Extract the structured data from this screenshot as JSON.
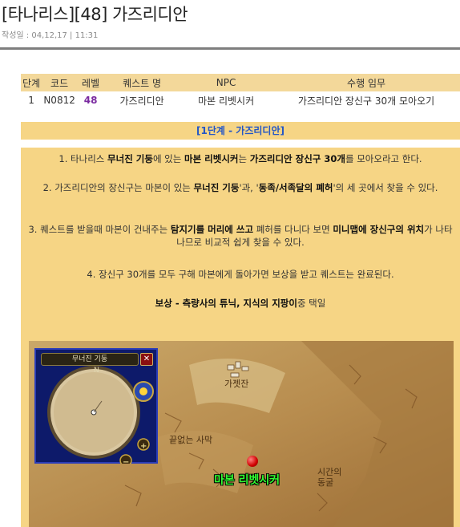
{
  "page": {
    "title": "[타나리스][48] 가즈리디안",
    "meta": "작성일 : 04,12,17 | 11:31"
  },
  "table": {
    "headers": [
      "단계",
      "코드",
      "레벨",
      "퀘스트 명",
      "NPC",
      "수행 임무"
    ],
    "rows": [
      [
        "1",
        "N0812",
        "48",
        "가즈리디안",
        "마본 리벳시커",
        "가즈리디안 장신구 30개 모아오기"
      ]
    ]
  },
  "stage_title": "[1단계 - 가즈리디안]",
  "body": {
    "p1": {
      "t1": "1. 타나리스 ",
      "b1": "무너진 기둥",
      "t2": "에 있는 ",
      "b2": "마본 리벳시커",
      "t3": "는 ",
      "b3": "가즈리디안 장신구 30개",
      "t4": "를 모아오라고 한다."
    },
    "p2": {
      "t1": "2. 가즈리디안의 장신구는 마본이 있는 ",
      "b1": "무너진 기둥",
      "t2": "'과, '",
      "b2": "동족/서족달의 폐허",
      "t3": "'의 세 곳에서 찾을 수 있다."
    },
    "p3": {
      "t1": "3. 퀘스트를 받을때 마본이 건내주는 ",
      "b1": "탐지기를 머리에 쓰고",
      "t2": " 폐허를 다니다 보면 ",
      "b2": "미니맵에 장신구의 위치",
      "t3": "가 나타나므로 비교적 쉽게 찾을 수 있다."
    },
    "p4": "4. 장신구 30개를 모두 구해 마본에게 돌아가면 보상을 받고 퀘스트는 완료된다.",
    "reward": {
      "b1": "보상 - 측량사의 튜닉, 지식의 지팡이",
      "t1": "중 택일"
    }
  },
  "map": {
    "minimap_title": "무너진 기둥",
    "minimap_n": "N",
    "labels": {
      "gadgetzan": "가젯잔",
      "desert": "끝없는 사막",
      "temple": "시간의\n동굴"
    },
    "npc_label": "마본 리벳시커"
  },
  "colors": {
    "header_bg": "#f3d89a",
    "body_bg": "#f6d585",
    "stage_text": "#2356c6",
    "level_text": "#7a2aa0",
    "npc_label": "#32ff32"
  }
}
